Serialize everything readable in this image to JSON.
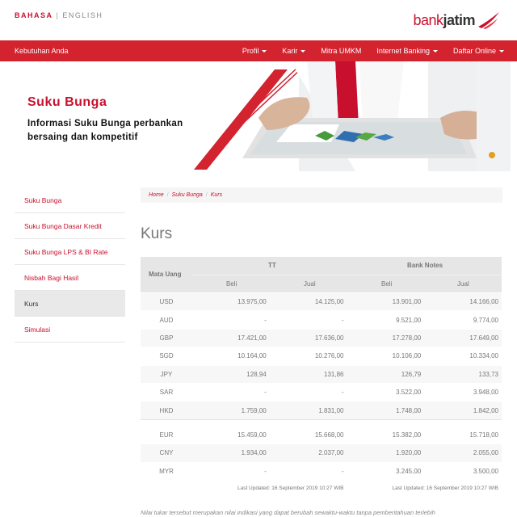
{
  "lang": {
    "active": "BAHASA",
    "separator": "|",
    "other": "ENGLISH"
  },
  "logo": {
    "text_light": "bank",
    "text_bold": "jatim"
  },
  "nav": {
    "brand": "Kebutuhan Anda",
    "items": [
      "Profil",
      "Karir",
      "Mitra UMKM",
      "Internet Banking",
      "Daftar Online"
    ]
  },
  "hero": {
    "title": "Suku Bunga",
    "subtitle": "Informasi Suku Bunga perbankan bersaing dan kompetitif"
  },
  "sidebar": {
    "items": [
      "Suku Bunga",
      "Suku Bunga Dasar Kredit",
      "Suku Bunga LPS & BI Rate",
      "Nisbah Bagi Hasil",
      "Kurs",
      "Simulasi"
    ]
  },
  "breadcrumb": [
    "Home",
    "Suku Bunga",
    "Kurs"
  ],
  "page_title": "Kurs",
  "table": {
    "col_currency": "Mata Uang",
    "group_tt": "TT",
    "group_bn": "Bank Notes",
    "beli": "Beli",
    "jual": "Jual",
    "rows_a": [
      [
        "USD",
        "13.975,00",
        "14.125,00",
        "13.901,00",
        "14.166,00"
      ],
      [
        "AUD",
        "-",
        "-",
        "9.521,00",
        "9.774,00"
      ],
      [
        "GBP",
        "17.421,00",
        "17.636,00",
        "17.278,00",
        "17.649,00"
      ],
      [
        "SGD",
        "10.164,00",
        "10.276,00",
        "10.106,00",
        "10.334,00"
      ],
      [
        "JPY",
        "128,94",
        "131,86",
        "126,79",
        "133,73"
      ],
      [
        "SAR",
        "-",
        "-",
        "3.522,00",
        "3.948,00"
      ],
      [
        "HKD",
        "1.759,00",
        "1.831,00",
        "1.748,00",
        "1.842,00"
      ]
    ],
    "rows_b": [
      [
        "EUR",
        "15.459,00",
        "15.668,00",
        "15.382,00",
        "15.718,00"
      ],
      [
        "CNY",
        "1.934,00",
        "2.037,00",
        "1.920,00",
        "2.055,00"
      ],
      [
        "MYR",
        "-",
        "-",
        "3.245,00",
        "3.500,00"
      ]
    ],
    "updated_tt": "Last Updated: 16 September 2019 10:27 WIB",
    "updated_bn": "Last Updated: 16 September 2019 10:27 WIB"
  },
  "note": "Nilai tukar tersebut merupakan nilai indikasi yang dapat berubah sewaktu-waktu tanpa pemberitahuan terlebih",
  "colors": {
    "brand_red": "#d2232f",
    "accent_red": "#c8102e"
  }
}
